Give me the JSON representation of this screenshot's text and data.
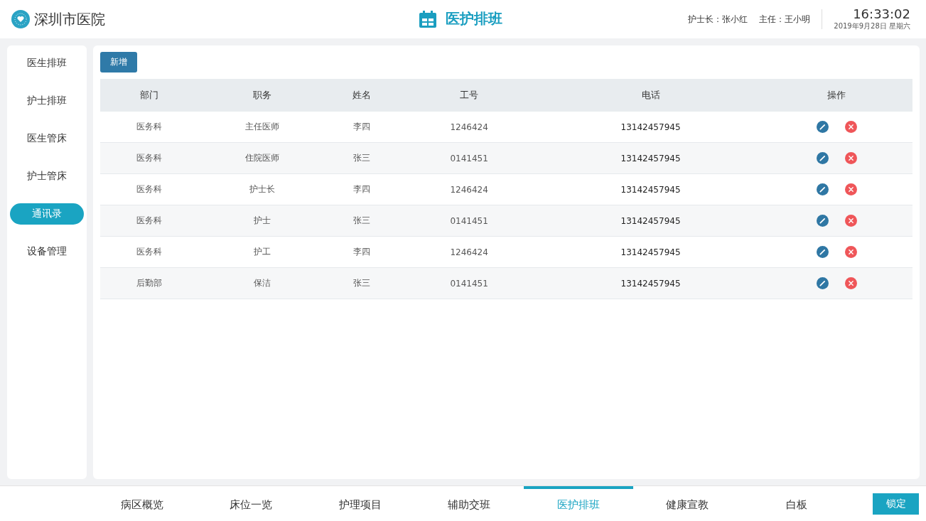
{
  "header": {
    "hospital": "深圳市医院",
    "title": "医护排班",
    "head_nurse": "护士长：张小红",
    "director": "主任：王小明",
    "time": "16:33:02",
    "date": "2019年9月28日 星期六"
  },
  "sidebar": {
    "items": [
      {
        "label": "医生排班",
        "selected": false
      },
      {
        "label": "护士排班",
        "selected": false
      },
      {
        "label": "医生管床",
        "selected": false
      },
      {
        "label": "护士管床",
        "selected": false
      },
      {
        "label": "通讯录",
        "selected": true
      },
      {
        "label": "设备管理",
        "selected": false
      }
    ]
  },
  "toolbar": {
    "add_button": "新增"
  },
  "table": {
    "columns": [
      "部门",
      "职务",
      "姓名",
      "工号",
      "电话",
      "操作"
    ],
    "rows": [
      [
        "医务科",
        "主任医师",
        "李四",
        "1246424",
        "13142457945"
      ],
      [
        "医务科",
        "住院医师",
        "张三",
        "0141451",
        "13142457945"
      ],
      [
        "医务科",
        "护士长",
        "李四",
        "1246424",
        "13142457945"
      ],
      [
        "医务科",
        "护士",
        "张三",
        "0141451",
        "13142457945"
      ],
      [
        "医务科",
        "护工",
        "李四",
        "1246424",
        "13142457945"
      ],
      [
        "后勤部",
        "保洁",
        "张三",
        "0141451",
        "13142457945"
      ]
    ]
  },
  "bottom_nav": {
    "tabs": [
      {
        "label": "病区概览",
        "selected": false
      },
      {
        "label": "床位一览",
        "selected": false
      },
      {
        "label": "护理项目",
        "selected": false
      },
      {
        "label": "辅助交班",
        "selected": false
      },
      {
        "label": "医护排班",
        "selected": true
      },
      {
        "label": "健康宣教",
        "selected": false
      },
      {
        "label": "白板",
        "selected": false
      }
    ],
    "lock_button": "锁定"
  }
}
